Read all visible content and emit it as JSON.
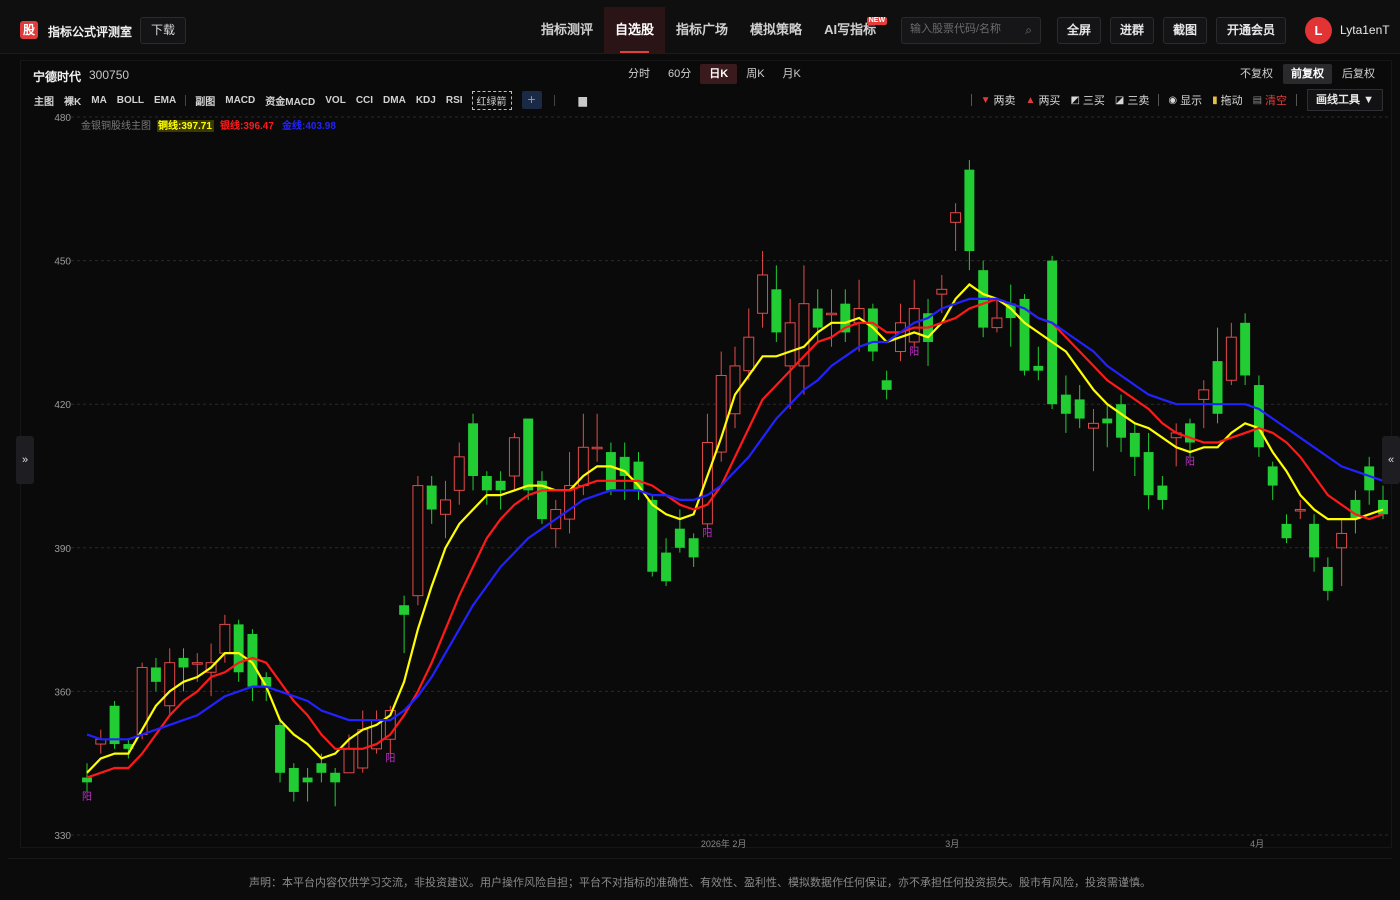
{
  "header": {
    "logo_char": "股",
    "app_title": "指标公式评测室",
    "download_label": "下载",
    "nav": [
      {
        "label": "指标测评",
        "active": false
      },
      {
        "label": "自选股",
        "active": true
      },
      {
        "label": "指标广场",
        "active": false
      },
      {
        "label": "模拟策略",
        "active": false
      },
      {
        "label": "AI写指标",
        "active": false,
        "badge": "NEW"
      }
    ],
    "search_placeholder": "输入股票代码/名称",
    "buttons": {
      "fullscreen": "全屏",
      "advanced": "进群",
      "screenshot": "截图",
      "vip": "开通会员"
    },
    "avatar_letter": "L",
    "username": "Lyta1enT"
  },
  "stock": {
    "name": "宁德时代",
    "code": "300750"
  },
  "periods": [
    {
      "label": "分时",
      "active": false
    },
    {
      "label": "60分",
      "active": false
    },
    {
      "label": "日K",
      "active": true
    },
    {
      "label": "周K",
      "active": false
    },
    {
      "label": "月K",
      "active": false
    }
  ],
  "adjust_modes": [
    {
      "label": "不复权",
      "active": false
    },
    {
      "label": "前复权",
      "active": true
    },
    {
      "label": "后复权",
      "active": false
    }
  ],
  "indicator_bar": {
    "main_groups": [
      "主图",
      "裸K",
      "MA",
      "BOLL",
      "EMA"
    ],
    "sub_groups": [
      "副图",
      "MACD",
      "资金MACD",
      "VOL",
      "CCI",
      "DMA",
      "KDJ",
      "RSI"
    ],
    "special": "红绿箭",
    "add": "+"
  },
  "draw_tools": [
    {
      "label": "两卖",
      "icon": "down-triangle-icon",
      "color": "#e23b3b"
    },
    {
      "label": "两买",
      "icon": "up-triangle-icon",
      "color": "#e23b3b"
    },
    {
      "label": "三买",
      "icon": "line-chart-icon",
      "color": "#d8d8d8"
    },
    {
      "label": "三卖",
      "icon": "diagonal-icon",
      "color": "#d8d8d8"
    },
    {
      "label": "显示",
      "icon": "eye-icon",
      "color": "#d8d8d8"
    },
    {
      "label": "拖动",
      "icon": "lock-icon",
      "color": "#d8d8d8"
    },
    {
      "label": "清空",
      "icon": "trash-icon",
      "color": "#e23b3b"
    }
  ],
  "draw_menu_label": "画线工具 ▼",
  "legend": {
    "title": "金银铜股线主图",
    "items": [
      {
        "label": "铜线:397.71",
        "color": "#ffff00",
        "bg": "#3a3a00"
      },
      {
        "label": "银线:396.47",
        "color": "#ff1a1a"
      },
      {
        "label": "金线:403.98",
        "color": "#2222ff"
      }
    ]
  },
  "chart_data": {
    "type": "candlestick",
    "y_ticks": [
      480,
      450,
      420,
      390,
      360,
      330
    ],
    "ylim": [
      330,
      480
    ],
    "x_labels": [
      "2026年  2月",
      "3月",
      "4月"
    ],
    "up_color": "#e24a4a",
    "down_color": "#22cc33",
    "signal_label": "阳",
    "candles": [
      {
        "o": 342,
        "c": 341,
        "h": 345,
        "l": 339
      },
      {
        "o": 349,
        "c": 350,
        "h": 352,
        "l": 347
      },
      {
        "o": 357,
        "c": 349,
        "h": 358,
        "l": 348
      },
      {
        "o": 349,
        "c": 348,
        "h": 350,
        "l": 346
      },
      {
        "o": 351,
        "c": 365,
        "h": 366,
        "l": 350
      },
      {
        "o": 365,
        "c": 362,
        "h": 367,
        "l": 360
      },
      {
        "o": 357,
        "c": 366,
        "h": 369,
        "l": 355
      },
      {
        "o": 367,
        "c": 365,
        "h": 369,
        "l": 360
      },
      {
        "o": 366,
        "c": 366,
        "h": 368,
        "l": 362
      },
      {
        "o": 364,
        "c": 366,
        "h": 370,
        "l": 359
      },
      {
        "o": 368,
        "c": 374,
        "h": 376,
        "l": 366
      },
      {
        "o": 374,
        "c": 364,
        "h": 375,
        "l": 362
      },
      {
        "o": 372,
        "c": 361,
        "h": 373,
        "l": 358
      },
      {
        "o": 363,
        "c": 361,
        "h": 364,
        "l": 358
      },
      {
        "o": 353,
        "c": 343,
        "h": 354,
        "l": 341
      },
      {
        "o": 344,
        "c": 339,
        "h": 345,
        "l": 337
      },
      {
        "o": 342,
        "c": 341,
        "h": 344,
        "l": 337
      },
      {
        "o": 345,
        "c": 343,
        "h": 347,
        "l": 341
      },
      {
        "o": 343,
        "c": 341,
        "h": 344,
        "l": 336
      },
      {
        "o": 343,
        "c": 348,
        "h": 351,
        "l": 343
      },
      {
        "o": 344,
        "c": 352,
        "h": 356,
        "l": 343
      },
      {
        "o": 348,
        "c": 354,
        "h": 356,
        "l": 347
      },
      {
        "o": 350,
        "c": 356,
        "h": 357,
        "l": 347
      },
      {
        "o": 378,
        "c": 376,
        "h": 380,
        "l": 368
      },
      {
        "o": 380,
        "c": 403,
        "h": 405,
        "l": 378
      },
      {
        "o": 403,
        "c": 398,
        "h": 405,
        "l": 395
      },
      {
        "o": 397,
        "c": 400,
        "h": 404,
        "l": 392
      },
      {
        "o": 402,
        "c": 409,
        "h": 412,
        "l": 399
      },
      {
        "o": 416,
        "c": 405,
        "h": 418,
        "l": 402
      },
      {
        "o": 405,
        "c": 402,
        "h": 406,
        "l": 399
      },
      {
        "o": 404,
        "c": 402,
        "h": 406,
        "l": 398
      },
      {
        "o": 405,
        "c": 413,
        "h": 414,
        "l": 402
      },
      {
        "o": 417,
        "c": 402,
        "h": 417,
        "l": 400
      },
      {
        "o": 404,
        "c": 396,
        "h": 406,
        "l": 395
      },
      {
        "o": 394,
        "c": 398,
        "h": 400,
        "l": 390
      },
      {
        "o": 396,
        "c": 403,
        "h": 410,
        "l": 393
      },
      {
        "o": 403,
        "c": 411,
        "h": 418,
        "l": 401
      },
      {
        "o": 411,
        "c": 411,
        "h": 418,
        "l": 408
      },
      {
        "o": 410,
        "c": 402,
        "h": 412,
        "l": 401
      },
      {
        "o": 409,
        "c": 405,
        "h": 412,
        "l": 400
      },
      {
        "o": 408,
        "c": 402,
        "h": 410,
        "l": 400
      },
      {
        "o": 400,
        "c": 385,
        "h": 401,
        "l": 384
      },
      {
        "o": 389,
        "c": 383,
        "h": 392,
        "l": 382
      },
      {
        "o": 394,
        "c": 390,
        "h": 398,
        "l": 389
      },
      {
        "o": 392,
        "c": 388,
        "h": 393,
        "l": 386
      },
      {
        "o": 395,
        "c": 412,
        "h": 418,
        "l": 394
      },
      {
        "o": 410,
        "c": 426,
        "h": 431,
        "l": 408
      },
      {
        "o": 418,
        "c": 428,
        "h": 432,
        "l": 415
      },
      {
        "o": 427,
        "c": 434,
        "h": 440,
        "l": 425
      },
      {
        "o": 439,
        "c": 447,
        "h": 452,
        "l": 436
      },
      {
        "o": 444,
        "c": 435,
        "h": 449,
        "l": 433
      },
      {
        "o": 428,
        "c": 437,
        "h": 442,
        "l": 419
      },
      {
        "o": 428,
        "c": 441,
        "h": 449,
        "l": 422
      },
      {
        "o": 440,
        "c": 436,
        "h": 444,
        "l": 433
      },
      {
        "o": 439,
        "c": 439,
        "h": 444,
        "l": 432
      },
      {
        "o": 441,
        "c": 435,
        "h": 444,
        "l": 433
      },
      {
        "o": 437,
        "c": 440,
        "h": 446,
        "l": 431
      },
      {
        "o": 440,
        "c": 431,
        "h": 441,
        "l": 429
      },
      {
        "o": 425,
        "c": 423,
        "h": 427,
        "l": 421
      },
      {
        "o": 431,
        "c": 437,
        "h": 441,
        "l": 429
      },
      {
        "o": 433,
        "c": 440,
        "h": 446,
        "l": 432
      },
      {
        "o": 439,
        "c": 433,
        "h": 442,
        "l": 428
      },
      {
        "o": 443,
        "c": 444,
        "h": 447,
        "l": 439
      },
      {
        "o": 458,
        "c": 460,
        "h": 462,
        "l": 452
      },
      {
        "o": 469,
        "c": 452,
        "h": 471,
        "l": 448
      },
      {
        "o": 448,
        "c": 436,
        "h": 450,
        "l": 434
      },
      {
        "o": 436,
        "c": 438,
        "h": 442,
        "l": 435
      },
      {
        "o": 441,
        "c": 438,
        "h": 445,
        "l": 432
      },
      {
        "o": 442,
        "c": 427,
        "h": 443,
        "l": 426
      },
      {
        "o": 428,
        "c": 427,
        "h": 432,
        "l": 425
      },
      {
        "o": 450,
        "c": 420,
        "h": 451,
        "l": 419
      },
      {
        "o": 422,
        "c": 418,
        "h": 426,
        "l": 414
      },
      {
        "o": 421,
        "c": 417,
        "h": 424,
        "l": 415
      },
      {
        "o": 415,
        "c": 416,
        "h": 419,
        "l": 406
      },
      {
        "o": 417,
        "c": 416,
        "h": 420,
        "l": 411
      },
      {
        "o": 420,
        "c": 413,
        "h": 422,
        "l": 410
      },
      {
        "o": 414,
        "c": 409,
        "h": 416,
        "l": 405
      },
      {
        "o": 410,
        "c": 401,
        "h": 414,
        "l": 398
      },
      {
        "o": 403,
        "c": 400,
        "h": 405,
        "l": 398
      },
      {
        "o": 413,
        "c": 414,
        "h": 416,
        "l": 407
      },
      {
        "o": 416,
        "c": 412,
        "h": 417,
        "l": 409
      },
      {
        "o": 421,
        "c": 423,
        "h": 425,
        "l": 415
      },
      {
        "o": 429,
        "c": 418,
        "h": 436,
        "l": 416
      },
      {
        "o": 425,
        "c": 434,
        "h": 437,
        "l": 424
      },
      {
        "o": 437,
        "c": 426,
        "h": 439,
        "l": 424
      },
      {
        "o": 424,
        "c": 411,
        "h": 426,
        "l": 409
      },
      {
        "o": 407,
        "c": 403,
        "h": 408,
        "l": 400
      },
      {
        "o": 395,
        "c": 392,
        "h": 397,
        "l": 391
      },
      {
        "o": 398,
        "c": 398,
        "h": 400,
        "l": 396
      },
      {
        "o": 395,
        "c": 388,
        "h": 397,
        "l": 385
      },
      {
        "o": 386,
        "c": 381,
        "h": 388,
        "l": 379
      },
      {
        "o": 390,
        "c": 393,
        "h": 396,
        "l": 382
      },
      {
        "o": 400,
        "c": 396,
        "h": 402,
        "l": 393
      },
      {
        "o": 407,
        "c": 402,
        "h": 409,
        "l": 399
      },
      {
        "o": 400,
        "c": 397,
        "h": 403,
        "l": 396
      }
    ],
    "series": [
      {
        "name": "铜线",
        "color": "#ffff00",
        "values": [
          343,
          346,
          347,
          347,
          352,
          357,
          360,
          362,
          363,
          365,
          368,
          368,
          366,
          361,
          354,
          351,
          349,
          346,
          347,
          350,
          352,
          353,
          355,
          362,
          373,
          382,
          390,
          395,
          398,
          401,
          401,
          402,
          403,
          403,
          402,
          402,
          405,
          407,
          407,
          406,
          403,
          399,
          397,
          396,
          397,
          405,
          413,
          422,
          426,
          430,
          430,
          431,
          432,
          435,
          437,
          437,
          438,
          436,
          433,
          434,
          435,
          434,
          437,
          442,
          445,
          443,
          442,
          440,
          437,
          435,
          433,
          431,
          427,
          423,
          420,
          418,
          416,
          415,
          413,
          411,
          410,
          411,
          411,
          414,
          416,
          415,
          410,
          406,
          401,
          398,
          396,
          396,
          396,
          397,
          398
        ]
      },
      {
        "name": "银线",
        "color": "#ff1a1a",
        "values": [
          342,
          343,
          344,
          344,
          347,
          351,
          355,
          358,
          360,
          363,
          364,
          366,
          367,
          366,
          362,
          358,
          355,
          351,
          348,
          348,
          348,
          349,
          351,
          355,
          360,
          366,
          373,
          380,
          386,
          392,
          396,
          399,
          401,
          402,
          402,
          402,
          403,
          404,
          404,
          404,
          404,
          403,
          401,
          399,
          398,
          399,
          403,
          409,
          415,
          421,
          424,
          427,
          430,
          433,
          434,
          436,
          437,
          437,
          435,
          435,
          436,
          436,
          437,
          438,
          440,
          441,
          442,
          441,
          440,
          438,
          437,
          434,
          431,
          428,
          425,
          423,
          421,
          419,
          416,
          414,
          413,
          412,
          412,
          413,
          414,
          415,
          414,
          412,
          409,
          405,
          401,
          399,
          397,
          396,
          397
        ]
      },
      {
        "name": "金线",
        "color": "#2222ff",
        "values": [
          351,
          350,
          350,
          350,
          351,
          352,
          353,
          354,
          355,
          357,
          359,
          360,
          361,
          361,
          360,
          359,
          358,
          356,
          355,
          354,
          354,
          354,
          354,
          356,
          359,
          363,
          368,
          373,
          378,
          382,
          386,
          389,
          392,
          394,
          396,
          398,
          400,
          401,
          402,
          402,
          402,
          401,
          401,
          400,
          400,
          401,
          403,
          406,
          409,
          413,
          417,
          420,
          423,
          425,
          428,
          430,
          432,
          433,
          433,
          435,
          437,
          438,
          440,
          441,
          442,
          442,
          442,
          441,
          440,
          438,
          437,
          435,
          433,
          431,
          428,
          426,
          424,
          422,
          421,
          420,
          420,
          420,
          420,
          420,
          420,
          419,
          417,
          415,
          413,
          411,
          409,
          407,
          406,
          405,
          404
        ]
      }
    ],
    "signals": [
      0,
      22,
      45,
      60,
      80
    ]
  }
}
